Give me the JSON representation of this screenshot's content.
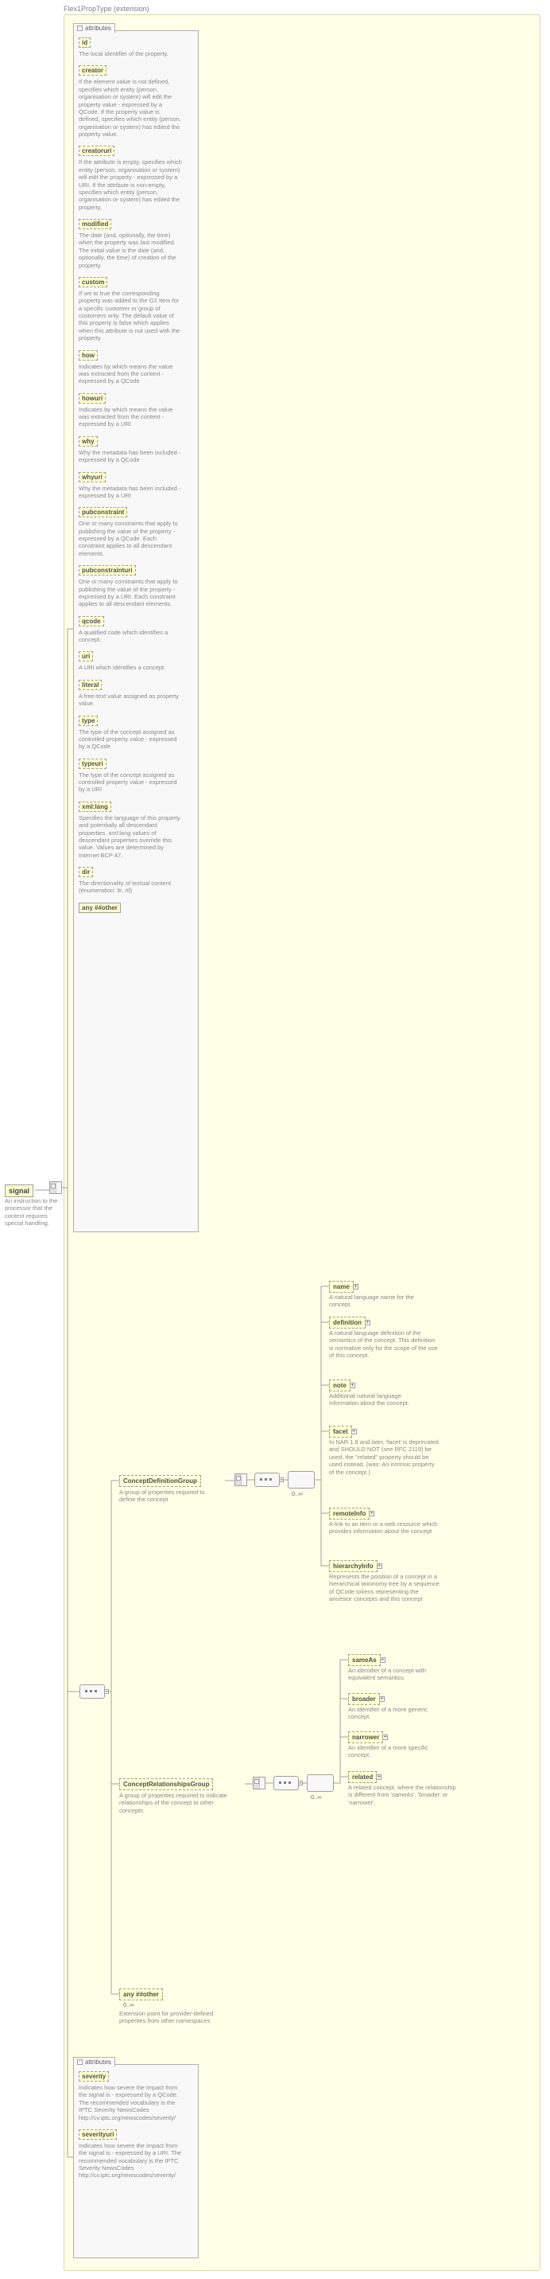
{
  "header": {
    "title": "Flex1PropType (extension)"
  },
  "root": {
    "name": "signal",
    "desc": "An instruction to the processor that the content requires special handling."
  },
  "attr_box1_label": "attributes",
  "attr_box2_label": "attributes",
  "any_other_label": "any ##other",
  "attrs1": [
    {
      "name": "id",
      "desc": "The local identifier of the property."
    },
    {
      "name": "creator",
      "desc": "If the element value is not defined, specifies which entity (person, organisation or system) will edit the property value - expressed by a QCode. If the property value is defined, specifies which entity (person, organisation or system) has edited the property value."
    },
    {
      "name": "creatoruri",
      "desc": "If the attribute is empty, specifies which entity (person, organisation or system) will edit the property - expressed by a URI. If the attribute is non-empty, specifies which entity (person, organisation or system) has edited the property."
    },
    {
      "name": "modified",
      "desc": "The date (and, optionally, the time) when the property was last modified. The initial value is the date (and, optionally, the time) of creation of the property."
    },
    {
      "name": "custom",
      "desc": "If set to true the corresponding property was added to the G2 Item for a specific customer or group of customers only. The default value of this property is false which applies when this attribute is not used with the property."
    },
    {
      "name": "how",
      "desc": "Indicates by which means the value was extracted from the content - expressed by a QCode"
    },
    {
      "name": "howuri",
      "desc": "Indicates by which means the value was extracted from the content - expressed by a URI"
    },
    {
      "name": "why",
      "desc": "Why the metadata has been included - expressed by a QCode"
    },
    {
      "name": "whyuri",
      "desc": "Why the metadata has been included - expressed by a URI"
    },
    {
      "name": "pubconstraint",
      "desc": "One or many constraints that apply to publishing the value of the property - expressed by a QCode. Each constraint applies to all descendant elements."
    },
    {
      "name": "pubconstrainturi",
      "desc": "One or many constraints that apply to publishing the value of the property - expressed by a URI. Each constraint applies to all descendant elements."
    },
    {
      "name": "qcode",
      "desc": "A qualified code which identifies a concept."
    },
    {
      "name": "uri",
      "desc": "A URI which identifies a concept."
    },
    {
      "name": "literal",
      "desc": "A free-text value assigned as property value."
    },
    {
      "name": "type",
      "desc": "The type of the concept assigned as controlled property value - expressed by a QCode"
    },
    {
      "name": "typeuri",
      "desc": "The type of the concept assigned as controlled property value - expressed by a URI"
    },
    {
      "name": "xml:lang",
      "desc": "Specifies the language of this property and potentially all descendant properties. xml:lang values of descendant properties override this value. Values are determined by Internet BCP 47."
    },
    {
      "name": "dir",
      "desc": "The directionality of textual content (enumeration: ltr, rtl)"
    }
  ],
  "groups": {
    "cdef": {
      "name": "ConceptDefinitionGroup",
      "desc": "A group of properties required to define the concept"
    },
    "crel": {
      "name": "ConceptRelationshipsGroup",
      "desc": "A group of properties required to indicate relationships of the concept to other concepts"
    }
  },
  "cdef_nodes": [
    {
      "name": "name",
      "desc": "A natural language name for the concept."
    },
    {
      "name": "definition",
      "desc": "A natural language definition of the semantics of the concept. This definition is normative only for the scope of the use of this concept."
    },
    {
      "name": "note",
      "desc": "Additional natural language information about the concept."
    },
    {
      "name": "facet",
      "desc": "In NAR 1.8 and later, 'facet' is deprecated and SHOULD NOT (see RFC 2119) be used, the \"related\" property should be used instead. (was: An intrinsic property of the concept.)"
    },
    {
      "name": "remoteInfo",
      "desc": "A link to an item or a web resource which provides information about the concept"
    },
    {
      "name": "hierarchyInfo",
      "desc": "Represents the position of a concept in a hierarchical taxonomy tree by a sequence of QCode tokens representing the ancestor concepts and this concept"
    }
  ],
  "crel_nodes": [
    {
      "name": "sameAs",
      "desc": "An identifier of a concept with equivalent semantics"
    },
    {
      "name": "broader",
      "desc": "An identifier of a more generic concept."
    },
    {
      "name": "narrower",
      "desc": "An identifier of a more specific concept."
    },
    {
      "name": "related",
      "desc": "A related concept, where the relationship is different from 'sameAs', 'broader' or 'narrower'."
    }
  ],
  "any_other": {
    "label": "any ##other",
    "desc": "Extension point for provider-defined properties from other namespaces"
  },
  "attrs2": [
    {
      "name": "severity",
      "desc": "Indicates how severe the impact from the signal is - expressed by a QCode. The recommended vocabulary is the IPTC Severity NewsCodes http://cv.iptc.org/newscodes/severity/"
    },
    {
      "name": "severityuri",
      "desc": "Indicates how severe the impact from the signal is - expressed by a URI. The recommended vocabulary is the IPTC Severity NewsCodes http://cv.iptc.org/newscodes/severity/"
    }
  ],
  "occurrence": "0..∞"
}
